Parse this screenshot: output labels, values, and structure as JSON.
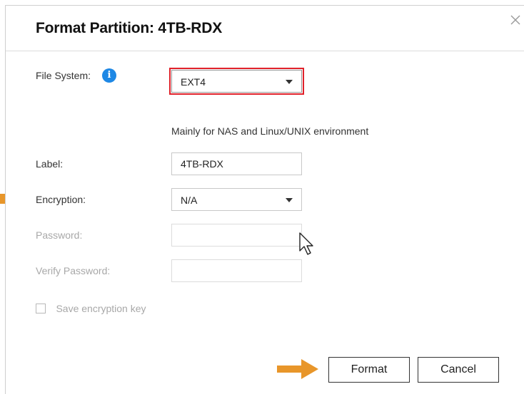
{
  "dialog": {
    "title": "Format Partition: 4TB-RDX"
  },
  "form": {
    "file_system": {
      "label": "File System:",
      "value": "EXT4",
      "description": "Mainly for NAS and Linux/UNIX environment"
    },
    "label_field": {
      "label": "Label:",
      "value": "4TB-RDX"
    },
    "encryption": {
      "label": "Encryption:",
      "value": "N/A"
    },
    "password": {
      "label": "Password:",
      "value": ""
    },
    "verify_password": {
      "label": "Verify Password:",
      "value": ""
    },
    "save_key": {
      "label": "Save encryption key",
      "checked": false
    }
  },
  "buttons": {
    "format": "Format",
    "cancel": "Cancel"
  },
  "icons": {
    "close": "close-icon",
    "info": "info-icon",
    "annotation_arrow": "arrow-right-icon",
    "cursor": "mouse-pointer-icon"
  },
  "colors": {
    "info_blue": "#1e88e5",
    "highlight_red": "#e0212a",
    "annotation_orange": "#e8962a"
  }
}
